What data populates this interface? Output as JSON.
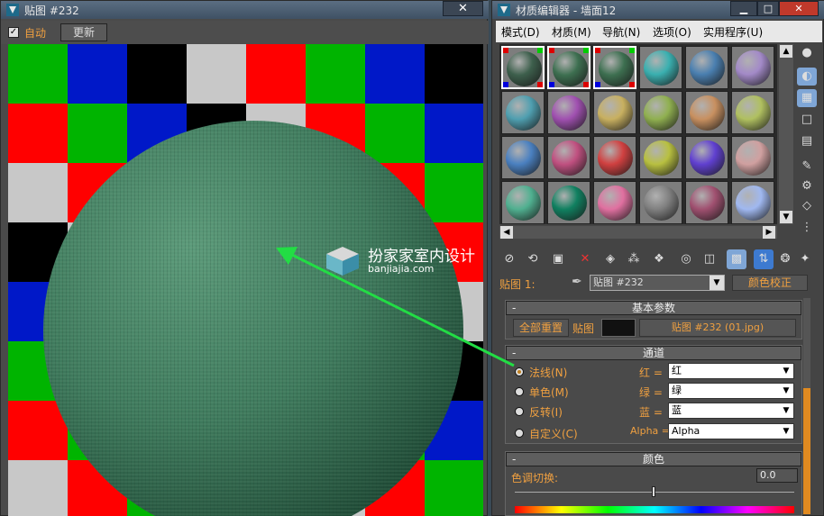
{
  "left_window": {
    "title": "贴图 #232",
    "close_label": "✕",
    "auto_label": "自动",
    "auto_checked": true,
    "update_label": "更新"
  },
  "watermark": {
    "line1": "扮家家室内设计",
    "line2": "banjiajia.com"
  },
  "right_window": {
    "title": "材质编辑器 - 墙面12",
    "menu": [
      "模式(D)",
      "材质(M)",
      "导航(N)",
      "选项(O)",
      "实用程序(U)"
    ],
    "map_label": "贴图 1:",
    "map_value": "贴图 #232",
    "color_correct": "颜色校正",
    "basic_params": {
      "title": "基本参数",
      "reset_all": "全部重置",
      "map_label": "贴图",
      "map_file": "贴图 #232 (01.jpg)"
    },
    "channel": {
      "title": "通道",
      "options": [
        {
          "label": "法线(N)",
          "selected": true
        },
        {
          "label": "单色(M)",
          "selected": false
        },
        {
          "label": "反转(I)",
          "selected": false
        },
        {
          "label": "自定义(C)",
          "selected": false
        }
      ],
      "rows": [
        {
          "label": "红 =",
          "value": "红"
        },
        {
          "label": "绿 =",
          "value": "绿"
        },
        {
          "label": "蓝 =",
          "value": "蓝"
        },
        {
          "label": "Alpha =",
          "value": "Alpha"
        }
      ]
    },
    "color": {
      "title": "颜色",
      "hue_label": "色调切换:",
      "hue_value": "0.0"
    }
  },
  "colors": {
    "accent": "#f0a040",
    "sphere": "#3e7a5c",
    "arrow": "#22dd44"
  }
}
